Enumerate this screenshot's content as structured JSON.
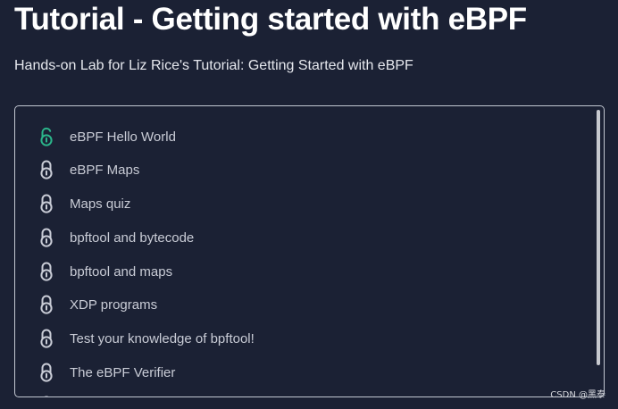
{
  "header": {
    "title": "Tutorial - Getting started with eBPF",
    "subtitle": "Hands-on Lab for Liz Rice's Tutorial: Getting Started with eBPF"
  },
  "lessons": [
    {
      "label": "eBPF Hello World",
      "status": "unlocked",
      "icon": "lock-open-icon"
    },
    {
      "label": "eBPF Maps",
      "status": "locked",
      "icon": "lock-icon"
    },
    {
      "label": "Maps quiz",
      "status": "locked",
      "icon": "lock-icon"
    },
    {
      "label": "bpftool and bytecode",
      "status": "locked",
      "icon": "lock-icon"
    },
    {
      "label": "bpftool and maps",
      "status": "locked",
      "icon": "lock-icon"
    },
    {
      "label": "XDP programs",
      "status": "locked",
      "icon": "lock-icon"
    },
    {
      "label": "Test your knowledge of bpftool!",
      "status": "locked",
      "icon": "lock-icon"
    },
    {
      "label": "The eBPF Verifier",
      "status": "locked",
      "icon": "lock-icon"
    }
  ],
  "colors": {
    "background": "#1b2134",
    "unlocked_icon": "#2bb58a",
    "locked_icon": "#c9ccd6",
    "panel_border": "#c3c8d2"
  },
  "watermark": "CSDN @黑泰"
}
